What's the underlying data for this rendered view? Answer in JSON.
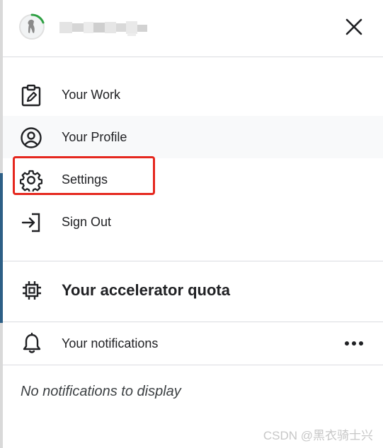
{
  "menu": {
    "items": [
      {
        "label": "Your Work",
        "icon": "clipboard-edit-icon"
      },
      {
        "label": "Your Profile",
        "icon": "account-circle-icon"
      },
      {
        "label": "Settings",
        "icon": "gear-icon"
      },
      {
        "label": "Sign Out",
        "icon": "sign-out-icon"
      }
    ]
  },
  "quota": {
    "title": "Your accelerator quota",
    "icon": "chip-icon"
  },
  "notifications": {
    "title": "Your notifications",
    "empty_text": "No notifications to display"
  },
  "watermark": "CSDN @黑衣骑士兴",
  "colors": {
    "highlight": "#e5271e",
    "avatar_ring": "#2ea043",
    "divider": "#dadce0"
  }
}
